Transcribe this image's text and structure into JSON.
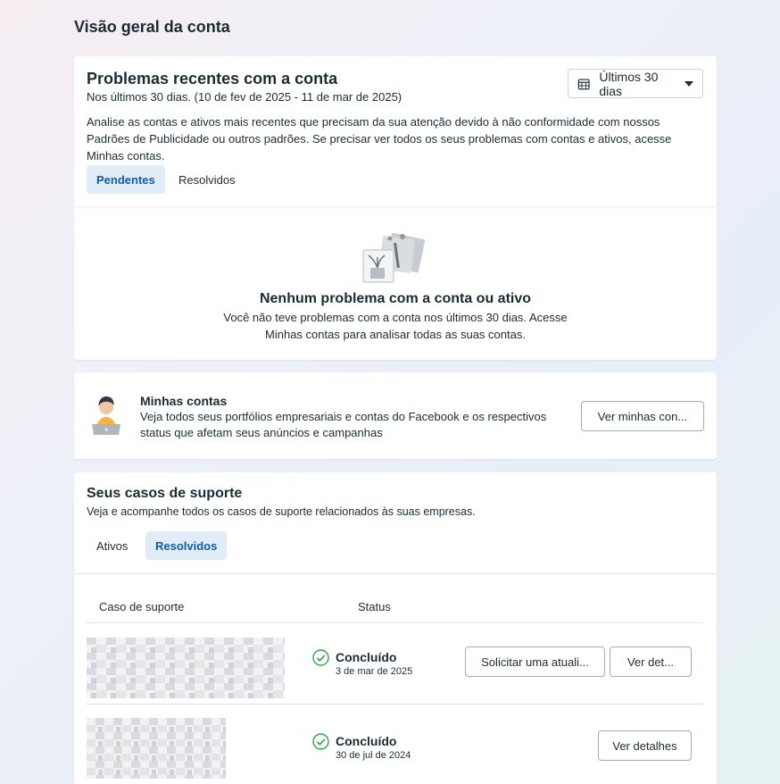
{
  "page": {
    "title": "Visão geral da conta"
  },
  "issues": {
    "title": "Problemas recentes com a conta",
    "range_text": "Nos últimos 30 dias. (10 de fev de 2025 - 11 de mar de 2025)",
    "range_button": "Últimos 30 dias",
    "description": "Analise as contas e ativos mais recentes que precisam da sua atenção devido à não conformidade com nossos Padrões de Publicidade ou outros padrões. Se precisar ver todos os seus problemas com contas e ativos, acesse Minhas contas.",
    "tabs": [
      {
        "label": "Pendentes"
      },
      {
        "label": "Resolvidos"
      }
    ],
    "empty_title": "Nenhum problema com a conta ou ativo",
    "empty_text": "Você não teve problemas com a conta nos últimos 30 dias. Acesse Minhas contas para analisar todas as suas contas."
  },
  "accounts": {
    "title": "Minhas contas",
    "text": "Veja todos seus portfólios empresariais e contas do Facebook e os respectivos status que afetam seus anúncios e campanhas",
    "button": "Ver minhas con..."
  },
  "support": {
    "title": "Seus casos de suporte",
    "subtitle": "Veja e acompanhe todos os casos de suporte relacionados às suas empresas.",
    "tabs": [
      {
        "label": "Ativos"
      },
      {
        "label": "Resolvidos"
      }
    ],
    "columns": {
      "case": "Caso de suporte",
      "status": "Status"
    },
    "rows": [
      {
        "status": "Concluído",
        "date": "3 de mar de 2025",
        "request_button": "Solicitar uma atuali...",
        "details_button": "Ver det..."
      },
      {
        "status": "Concluído",
        "date": "30 de jul de 2024",
        "details_button": "Ver detalhes"
      }
    ]
  },
  "colors": {
    "accent": "#0a5eaa",
    "tab_active_bg": "#e0ecf7",
    "success": "#31a24c"
  }
}
